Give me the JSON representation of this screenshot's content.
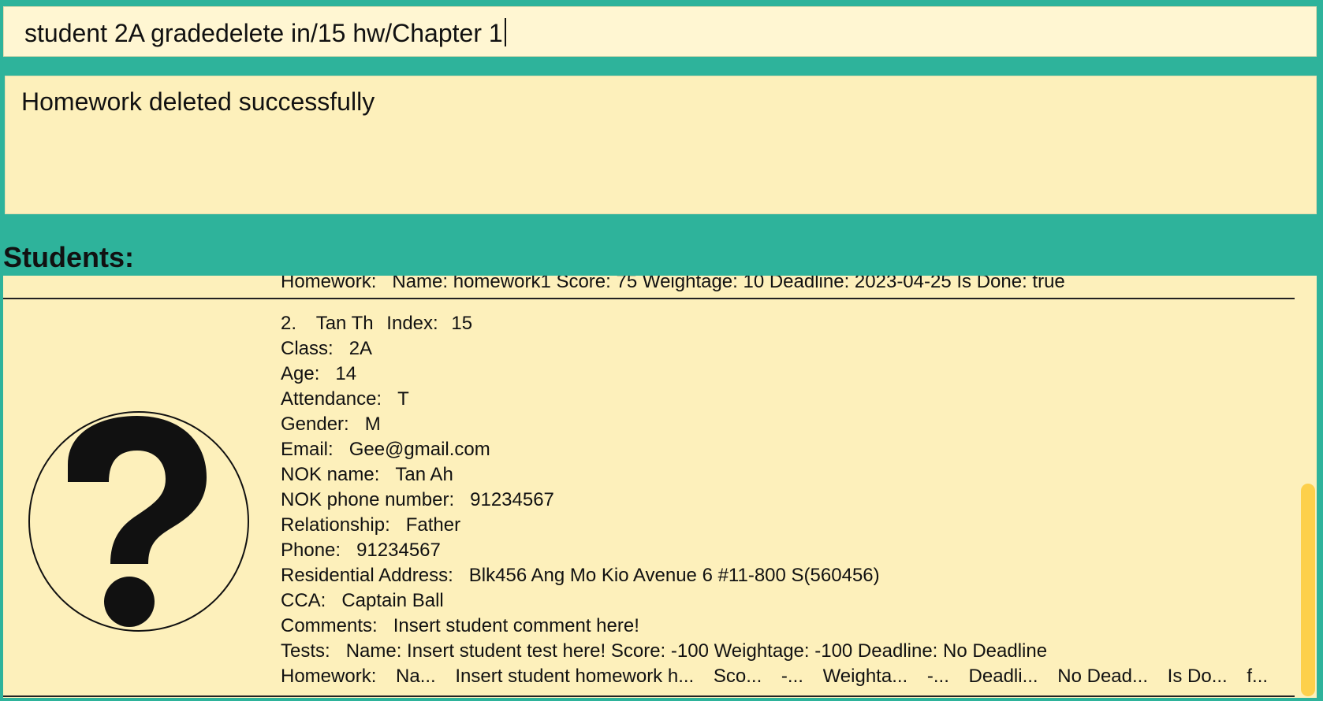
{
  "command": {
    "value": "student 2A gradedelete in/15 hw/Chapter 1"
  },
  "result": {
    "message": "Homework deleted successfully"
  },
  "list": {
    "title": "Students:",
    "previous_card_last_line": {
      "label": "Homework:",
      "value": "Name: homework1 Score: 75 Weightage: 10 Deadline: 2023-04-25 Is Done: true"
    },
    "student": {
      "number": "2.",
      "name": "Tan Th",
      "index_label": "Index:",
      "index_value": "15",
      "class_label": "Class:",
      "class_value": "2A",
      "age_label": "Age:",
      "age_value": "14",
      "attendance_label": "Attendance:",
      "attendance_value": "T",
      "gender_label": "Gender:",
      "gender_value": "M",
      "email_label": "Email:",
      "email_value": "Gee@gmail.com",
      "nok_name_label": "NOK name:",
      "nok_name_value": "Tan Ah",
      "nok_phone_label": "NOK phone number:",
      "nok_phone_value": "91234567",
      "relationship_label": "Relationship:",
      "relationship_value": "Father",
      "phone_label": "Phone:",
      "phone_value": "91234567",
      "address_label": "Residential Address:",
      "address_value": "Blk456 Ang Mo Kio Avenue 6 #11-800 S(560456)",
      "cca_label": "CCA:",
      "cca_value": "Captain Ball",
      "comments_label": "Comments:",
      "comments_value": "Insert student comment here!",
      "tests_label": "Tests:",
      "tests_value": "Name: Insert student test here! Score: -100 Weightage: -100 Deadline: No Deadline",
      "homework_label": "Homework:",
      "homework_parts": [
        "Na...",
        "Insert student homework h...",
        "Sco...",
        "-...",
        "Weighta...",
        "-...",
        "Deadli...",
        "No Dead...",
        "Is Do...",
        "f..."
      ],
      "avatar_icon": "question-mark-icon"
    }
  },
  "colors": {
    "background": "#2eb39b",
    "panel": "#fdf0bb",
    "command_bg": "#fff6d2",
    "scroll_thumb": "#fdd04b"
  }
}
